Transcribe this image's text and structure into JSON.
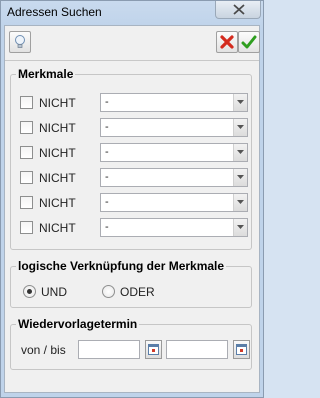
{
  "window": {
    "title": "Adressen Suchen",
    "close_icon": "close-x-icon"
  },
  "toolbar": {
    "tip_icon": "lightbulb-icon",
    "cancel_icon": "red-x-cancel-icon",
    "ok_icon": "green-check-icon",
    "colors": {
      "cancel": "#d42b1e",
      "ok": "#2f9e1f"
    }
  },
  "merkmale": {
    "legend": "Merkmale",
    "rows": [
      {
        "label": "NICHT",
        "value": "-"
      },
      {
        "label": "NICHT",
        "value": "-"
      },
      {
        "label": "NICHT",
        "value": "-"
      },
      {
        "label": "NICHT",
        "value": "-"
      },
      {
        "label": "NICHT",
        "value": "-"
      },
      {
        "label": "NICHT",
        "value": "-"
      }
    ]
  },
  "verknuepfung": {
    "legend": "logische Verknüpfung der Merkmale",
    "options": [
      {
        "label": "UND",
        "selected": true
      },
      {
        "label": "ODER",
        "selected": false
      }
    ]
  },
  "wiedervorlage": {
    "legend": "Wiedervorlagetermin",
    "range_label": "von / bis",
    "from_value": "",
    "to_value": "",
    "calendar_icon": "calendar-icon"
  }
}
